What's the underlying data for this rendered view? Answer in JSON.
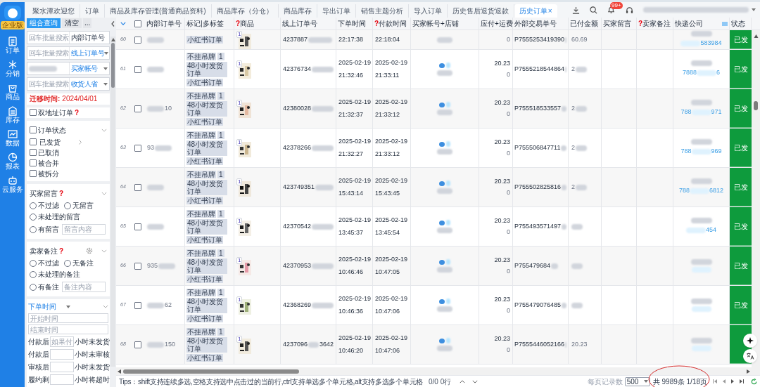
{
  "app": {
    "edition": "企业版"
  },
  "nav": [
    {
      "label": "订单"
    },
    {
      "label": "分销"
    },
    {
      "label": "商品"
    },
    {
      "label": "库存"
    },
    {
      "label": "数据"
    },
    {
      "label": "报表"
    },
    {
      "label": "云服务"
    }
  ],
  "tabs": [
    {
      "label": "聚水潭欢迎您",
      "selected": false
    },
    {
      "label": "订单",
      "selected": false
    },
    {
      "label": "商品及库存管理(普通商品资料)",
      "selected": false
    },
    {
      "label": "商品库存（分仓）",
      "selected": false
    },
    {
      "label": "商品库存",
      "selected": false
    },
    {
      "label": "导出订单",
      "selected": false
    },
    {
      "label": "销售主题分析",
      "selected": false
    },
    {
      "label": "导入订单",
      "selected": false
    },
    {
      "label": "历史售后退货退款",
      "selected": false
    },
    {
      "label": "历史订单",
      "selected": true,
      "close": "×"
    }
  ],
  "topbar": {
    "notification_badge": "99+"
  },
  "filter": {
    "query_button": "组合查询",
    "clear_button": "清空",
    "more": "...",
    "search_rows": [
      {
        "placeholder": "回车批量搜索",
        "field": "内部订单号",
        "dropdown": false
      },
      {
        "placeholder": "回车批量搜索",
        "field": "线上订单号",
        "dropdown": true
      },
      {
        "field": "买家帐号",
        "dropdown": true
      },
      {
        "placeholder": "回车批量搜索",
        "field": "收货人省",
        "dropdown": true
      }
    ],
    "migration": {
      "label": "迁移时间:",
      "value": "2024/04/01"
    },
    "dual_address": {
      "label": "双地址订单",
      "help": "?",
      "checked": false
    },
    "order_status": {
      "label": "订单状态",
      "checked": false,
      "options": [
        {
          "label": "已发货",
          "checked": false,
          "submenu": true
        },
        {
          "label": "已取消",
          "checked": false,
          "submenu": false
        },
        {
          "label": "被合并",
          "checked": false,
          "submenu": false
        },
        {
          "label": "被拆分",
          "checked": false,
          "submenu": false
        }
      ]
    },
    "buyer_message": {
      "title": "买家留言",
      "help": "?",
      "options": [
        {
          "label": "不过滤",
          "selected": false
        },
        {
          "label": "无留言",
          "selected": false
        },
        {
          "label": "未处理的留言",
          "selected": false
        },
        {
          "label": "有留言",
          "selected": false
        }
      ],
      "content_placeholder": "留言内容"
    },
    "seller_remark": {
      "title": "卖家备注",
      "help": "?",
      "options": [
        {
          "label": "不过滤",
          "selected": false
        },
        {
          "label": "无备注",
          "selected": false
        },
        {
          "label": "未处理的备注",
          "selected": false
        },
        {
          "label": "有备注",
          "selected": false
        }
      ],
      "content_placeholder": "备注内容"
    },
    "time_filter": {
      "type": "下单时间",
      "start_placeholder": "开始时间",
      "end_placeholder": "结束时间",
      "rules": [
        {
          "before": "付款后",
          "placeholder": "如果付",
          "after": "小时未发货"
        },
        {
          "before": "付款后",
          "after": "小时未审核"
        },
        {
          "before": "审核后",
          "after": "小时未发货"
        },
        {
          "before": "履约剩",
          "after": "小时将超时"
        }
      ]
    }
  },
  "table": {
    "header_checked": false,
    "columns": [
      {
        "label": "内部订单号"
      },
      {
        "label": "标记|多标签"
      },
      {
        "label": "商品",
        "help": "?"
      },
      {
        "label": "线上订单号"
      },
      {
        "label": "下单时间"
      },
      {
        "label": "付款时间",
        "help": "?"
      },
      {
        "label": "买家帐号+店铺"
      },
      {
        "label": "应付+运费"
      },
      {
        "label": "外部交易单号"
      },
      {
        "label": "已付金额"
      },
      {
        "label": "买家留言"
      },
      {
        "label": "卖家备注",
        "help": "?"
      },
      {
        "label": "快递公司"
      },
      {
        "label": "状态"
      }
    ],
    "rows": [
      {
        "no": "60",
        "checked": false,
        "tags": [
          {
            "text": "小红书订单"
          }
        ],
        "qty": "1",
        "online": "4237887",
        "order_time": {
          "time": "22:17:38"
        },
        "pay_time": {
          "time": "22:18:04"
        },
        "amount": {
          "freight": "0"
        },
        "ext": "P7555253419390",
        "paid": "60.69",
        "tracking_tail": "583984",
        "status": "已发"
      },
      {
        "no": "61",
        "checked": false,
        "tags": [
          {
            "text": "不挂吊牌",
            "count": "1"
          },
          {
            "text": "48小时发货订单"
          },
          {
            "text": "小红书订单"
          }
        ],
        "qty": "1",
        "online": "42376734",
        "order_time": {
          "date": "2025-02-19",
          "time": "21:32:46"
        },
        "pay_time": {
          "date": "2025-02-19",
          "time": "21:33:11"
        },
        "amount": {
          "due": "20.23",
          "freight": "0"
        },
        "ext": "P7555218544864",
        "paid": "2",
        "tracking_head": "7888",
        "tracking_tail": "6",
        "status": "已发"
      },
      {
        "no": "62",
        "checked": false,
        "internal_tail": "10",
        "tags": [
          {
            "text": "不挂吊牌",
            "count": "1"
          },
          {
            "text": "48小时发货订单"
          },
          {
            "text": "小红书订单"
          }
        ],
        "qty": "1",
        "online": "42380028",
        "order_time": {
          "date": "2025-02-19",
          "time": "21:32:37"
        },
        "pay_time": {
          "date": "2025-02-19",
          "time": "21:33:12"
        },
        "amount": {
          "due": "20.23",
          "freight": "0"
        },
        "ext": "P755518533557",
        "paid": "2",
        "tracking_head": "788",
        "tracking_tail": "971",
        "status": "已发"
      },
      {
        "no": "63",
        "checked": false,
        "internal": "93",
        "tags": [
          {
            "text": "不挂吊牌",
            "count": "1"
          },
          {
            "text": "48小时发货订单"
          },
          {
            "text": "小红书订单"
          }
        ],
        "qty": "1",
        "online": "42378266",
        "order_time": {
          "date": "2025-02-19",
          "time": "21:32:27"
        },
        "pay_time": {
          "date": "2025-02-19",
          "time": "21:33:12"
        },
        "amount": {
          "due": "20.23",
          "freight": "0"
        },
        "ext": "P755506847711",
        "paid": "2",
        "tracking_head": "788",
        "tracking_tail": "969",
        "status": "已发"
      },
      {
        "no": "64",
        "checked": false,
        "tags": [
          {
            "text": "不挂吊牌",
            "count": "1"
          },
          {
            "text": "48小时发货订单"
          },
          {
            "text": "小红书订单"
          }
        ],
        "qty": "1",
        "online": "423749351",
        "order_time": {
          "date": "2025-02-19",
          "time": "15:43:14"
        },
        "pay_time": {
          "date": "2025-02-19",
          "time": "15:43:45"
        },
        "amount": {
          "due": "20.23",
          "freight": "0"
        },
        "ext": "P755502825816",
        "paid": "2",
        "tracking_head": "788",
        "tracking_tail": "6812",
        "status": "已发"
      },
      {
        "no": "65",
        "checked": false,
        "tags": [
          {
            "text": "不挂吊牌",
            "count": "1"
          },
          {
            "text": "48小时发货订单"
          },
          {
            "text": "小红书订单"
          }
        ],
        "qty": "1",
        "online": "42370542",
        "order_time": {
          "date": "2025-02-19",
          "time": "13:45:37"
        },
        "pay_time": {
          "date": "2025-02-19",
          "time": "13:45:54"
        },
        "amount": {
          "due": "20.23",
          "freight": "0"
        },
        "ext": "P755493571497",
        "tracking_tail": "454",
        "status": "已发"
      },
      {
        "no": "66",
        "checked": false,
        "internal": "935",
        "tags": [
          {
            "text": "不挂吊牌",
            "count": "1"
          },
          {
            "text": "48小时发货订单"
          },
          {
            "text": "小红书订单"
          }
        ],
        "qty": "1",
        "online": "42370953",
        "order_time": {
          "date": "2025-02-19",
          "time": "10:46:46"
        },
        "pay_time": {
          "date": "2025-02-19",
          "time": "10:47:05"
        },
        "amount": {
          "due": "20.23",
          "freight": "0"
        },
        "ext": "P755479684",
        "status": "已发"
      },
      {
        "no": "67",
        "checked": false,
        "internal_tail": "62",
        "tags": [
          {
            "text": "不挂吊牌",
            "count": "1"
          },
          {
            "text": "48小时发货订单"
          },
          {
            "text": "小红书订单"
          }
        ],
        "qty": "1",
        "online": "42368269",
        "order_time": {
          "date": "2025-02-19",
          "time": "10:46:36"
        },
        "pay_time": {
          "date": "2025-02-19",
          "time": "10:47:06"
        },
        "amount": {
          "due": "20.23",
          "freight": "0"
        },
        "ext": "P755479076485",
        "status": "已发"
      },
      {
        "no": "68",
        "checked": false,
        "internal_tail": "150",
        "tags": [
          {
            "text": "不挂吊牌",
            "count": "1"
          },
          {
            "text": "48小时发货订单"
          },
          {
            "text": "小红书订单"
          }
        ],
        "qty": "1",
        "online": "4237096",
        "online_tail": "3642",
        "order_time": {
          "date": "2025-02-19",
          "time": "10:46:20"
        },
        "pay_time": {
          "date": "2025-02-19",
          "time": "10:47:06"
        },
        "amount": {
          "due": "20.23",
          "freight": "0"
        },
        "ext": "P7555446052166",
        "paid": "20.23"
      }
    ]
  },
  "footer": {
    "tips": "Tips：shift支持连续多选,空格支持选中点击过的当前行,ctrl支持单选多个单元格,alt支持多选多个单元格",
    "selection": "0/0 0行",
    "page_size_label": "每页记录数",
    "page_size": "500",
    "total": "共 9989条 1/18页"
  }
}
